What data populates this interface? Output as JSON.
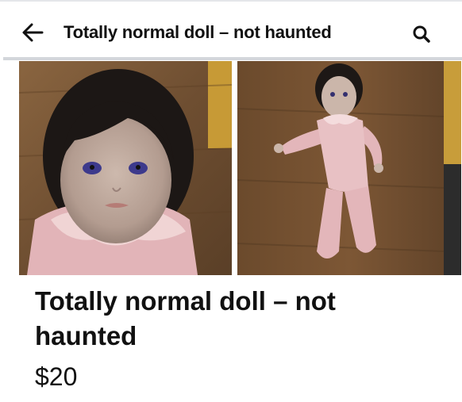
{
  "header": {
    "title": "Totally normal doll – not haunted",
    "back_icon": "arrow-left-icon",
    "search_icon": "search-icon"
  },
  "gallery": {
    "photos": [
      {
        "name": "doll-face-closeup"
      },
      {
        "name": "doll-full-body"
      }
    ]
  },
  "listing": {
    "title": "Totally normal doll – not haunted",
    "price": "$20"
  },
  "colors": {
    "text": "#111111",
    "divider": "#d3d6db",
    "background": "#ffffff"
  }
}
